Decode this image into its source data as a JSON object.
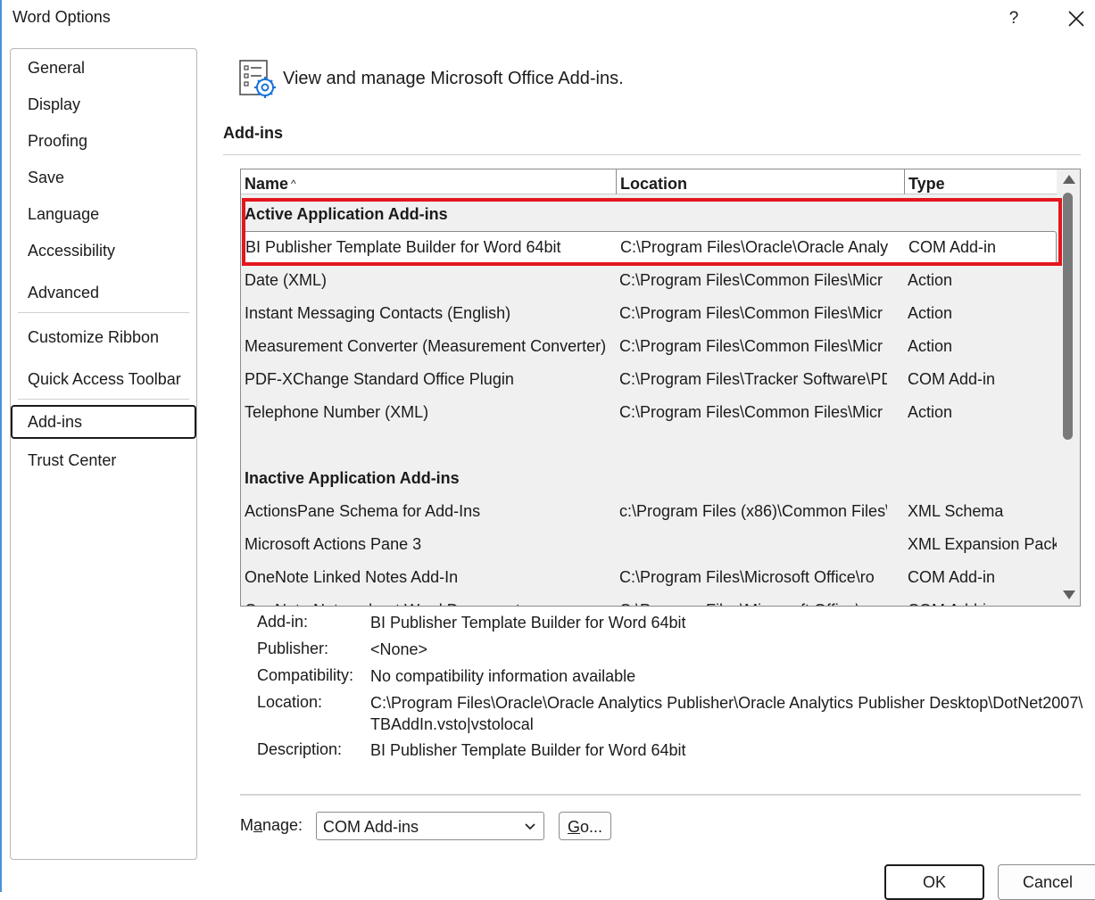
{
  "window": {
    "title": "Word Options",
    "help_label": "?"
  },
  "sidebar": {
    "items": [
      {
        "label": "General"
      },
      {
        "label": "Display"
      },
      {
        "label": "Proofing"
      },
      {
        "label": "Save"
      },
      {
        "label": "Language"
      },
      {
        "label": "Accessibility"
      },
      {
        "label": "Advanced"
      },
      {
        "label": "Customize Ribbon"
      },
      {
        "label": "Quick Access Toolbar"
      },
      {
        "label": "Add-ins",
        "selected": true
      },
      {
        "label": "Trust Center"
      }
    ]
  },
  "header": {
    "text": "View and manage Microsoft Office Add-ins."
  },
  "section": {
    "title": "Add-ins"
  },
  "table": {
    "columns": {
      "name": "Name",
      "location": "Location",
      "type": "Type"
    },
    "sort_indicator": "^",
    "active_group": "Active Application Add-ins",
    "active_rows": [
      {
        "name": "BI Publisher Template Builder for Word 64bit",
        "location": "C:\\Program Files\\Oracle\\Oracle Analy",
        "type": "COM Add-in",
        "selected": true
      },
      {
        "name": "Date (XML)",
        "location": "C:\\Program Files\\Common Files\\Micr",
        "type": "Action"
      },
      {
        "name": "Instant Messaging Contacts (English)",
        "location": "C:\\Program Files\\Common Files\\Micr",
        "type": "Action"
      },
      {
        "name": "Measurement Converter (Measurement Converter)",
        "location": "C:\\Program Files\\Common Files\\Micr",
        "type": "Action"
      },
      {
        "name": "PDF-XChange Standard Office Plugin",
        "location": "C:\\Program Files\\Tracker Software\\PD",
        "type": "COM Add-in"
      },
      {
        "name": "Telephone Number (XML)",
        "location": "C:\\Program Files\\Common Files\\Micr",
        "type": "Action"
      }
    ],
    "inactive_group": "Inactive Application Add-ins",
    "inactive_rows": [
      {
        "name": "ActionsPane Schema for Add-Ins",
        "location": "c:\\Program Files (x86)\\Common Files\\",
        "type": "XML Schema"
      },
      {
        "name": "Microsoft Actions Pane 3",
        "location": "",
        "type": "XML Expansion Pack"
      },
      {
        "name": "OneNote Linked Notes Add-In",
        "location": "C:\\Program Files\\Microsoft Office\\ro",
        "type": "COM Add-in"
      },
      {
        "name": "OneNote Notes about Word Documents",
        "location": "C:\\Program Files\\Microsoft Office\\ro",
        "type": "COM Add-in"
      }
    ]
  },
  "details": {
    "addin_label": "Add-in:",
    "addin_value": "BI Publisher Template Builder for Word 64bit",
    "publisher_label": "Publisher:",
    "publisher_value": "<None>",
    "compat_label": "Compatibility:",
    "compat_value": "No compatibility information available",
    "location_label": "Location:",
    "location_value_line1": "C:\\Program Files\\Oracle\\Oracle Analytics Publisher\\Oracle Analytics Publisher Desktop\\DotNet2007\\",
    "location_value_line2": "TBAddIn.vsto|vstolocal",
    "description_label": "Description:",
    "description_value": "BI Publisher Template Builder for Word 64bit"
  },
  "manage": {
    "label_prefix": "M",
    "label_underlined": "a",
    "label_suffix": "nage:",
    "selected": "COM Add-ins",
    "go_prefix": "",
    "go_underlined": "G",
    "go_suffix": "o..."
  },
  "footer": {
    "ok": "OK",
    "cancel": "Cancel"
  },
  "colors": {
    "highlight": "#e3161e",
    "accent_border": "#4a90d9",
    "icon_blue": "#1a73d9"
  }
}
